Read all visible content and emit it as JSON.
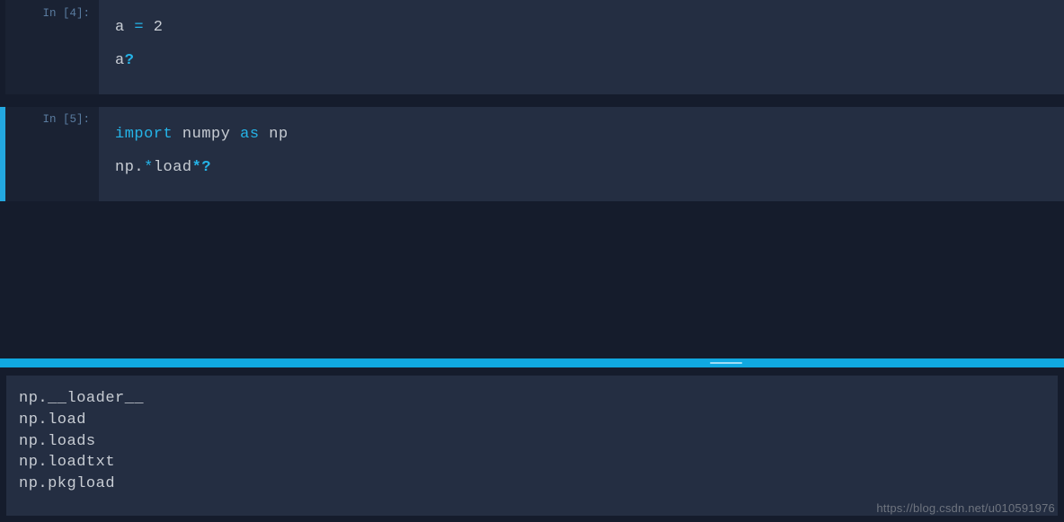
{
  "cells": [
    {
      "prompt": "In [4]:",
      "lines": [
        {
          "tokens": [
            {
              "t": "a ",
              "cls": "tok-var"
            },
            {
              "t": "=",
              "cls": "tok-op"
            },
            {
              "t": " 2",
              "cls": "tok-num"
            }
          ]
        },
        {
          "tokens": [
            {
              "t": "a",
              "cls": "tok-var"
            },
            {
              "t": "?",
              "cls": "tok-q"
            }
          ]
        },
        {
          "tokens": [
            {
              "t": " ",
              "cls": "tok-var"
            }
          ]
        }
      ]
    },
    {
      "prompt": "In [5]:",
      "lines": [
        {
          "tokens": [
            {
              "t": "import",
              "cls": "tok-keyword"
            },
            {
              "t": " numpy ",
              "cls": "tok-name"
            },
            {
              "t": "as",
              "cls": "tok-keyword"
            },
            {
              "t": " np",
              "cls": "tok-name"
            }
          ]
        },
        {
          "tokens": [
            {
              "t": "np.",
              "cls": "tok-name"
            },
            {
              "t": "*",
              "cls": "tok-star"
            },
            {
              "t": "load",
              "cls": "tok-name"
            },
            {
              "t": "*?",
              "cls": "tok-q"
            }
          ]
        }
      ]
    }
  ],
  "output_lines": [
    "np.__loader__",
    "np.load",
    "np.loads",
    "np.loadtxt",
    "np.pkgload"
  ],
  "watermark": "https://blog.csdn.net/u010591976"
}
